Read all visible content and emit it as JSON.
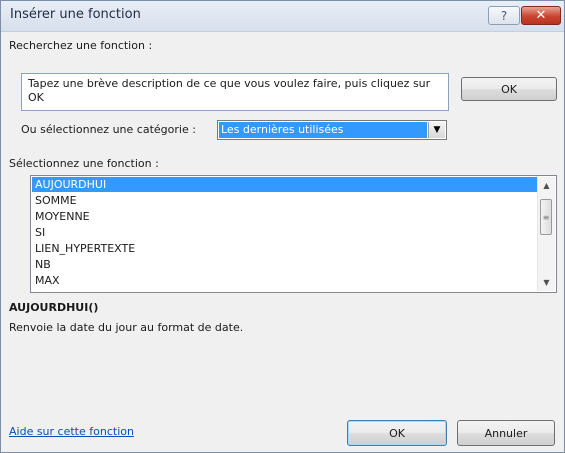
{
  "window": {
    "title": "Insérer une fonction",
    "help_glyph": "?",
    "close_glyph": "✕"
  },
  "search": {
    "label": "Recherchez une fonction :",
    "description": "Tapez une brève description de ce que vous voulez faire, puis cliquez sur OK",
    "ok_label": "OK"
  },
  "category": {
    "label": "Ou sélectionnez une catégorie :",
    "selected": "Les dernières utilisées"
  },
  "functions": {
    "label": "Sélectionnez une fonction :",
    "items": [
      "AUJOURDHUI",
      "SOMME",
      "MOYENNE",
      "SI",
      "LIEN_HYPERTEXTE",
      "NB",
      "MAX"
    ],
    "selected_index": 0
  },
  "details": {
    "signature": "AUJOURDHUI()",
    "description": "Renvoie la date du jour au format de date."
  },
  "footer": {
    "help_link": "Aide sur cette fonction",
    "ok_label": "OK",
    "cancel_label": "Annuler"
  },
  "colors": {
    "selection": "#3399ff",
    "link": "#0b4db3",
    "close_button": "#c8452f"
  }
}
